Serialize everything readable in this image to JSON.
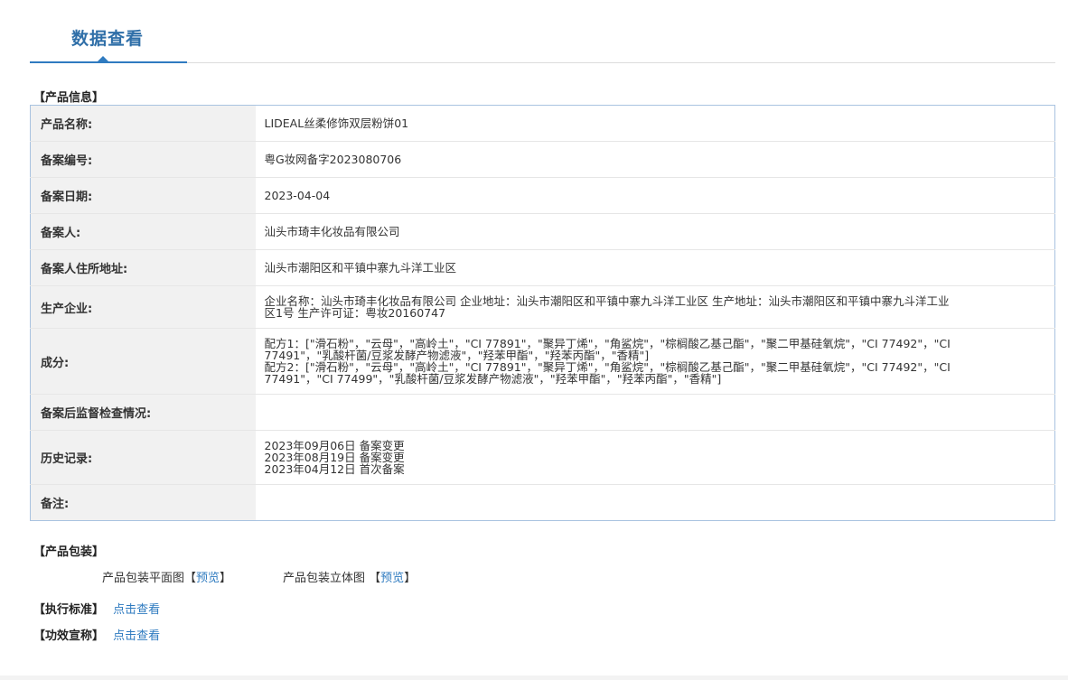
{
  "header": {
    "tab_title": "数据查看"
  },
  "product_info": {
    "section_title": "【产品信息】",
    "rows": [
      {
        "label": "产品名称:",
        "lines": [
          "LIDEAL丝柔修饰双层粉饼01"
        ]
      },
      {
        "label": "备案编号:",
        "lines": [
          "粤G妆网备字2023080706"
        ]
      },
      {
        "label": "备案日期:",
        "lines": [
          "2023-04-04"
        ]
      },
      {
        "label": "备案人:",
        "lines": [
          "汕头市琦丰化妆品有限公司"
        ]
      },
      {
        "label": "备案人住所地址:",
        "lines": [
          "汕头市潮阳区和平镇中寨九斗洋工业区"
        ]
      },
      {
        "label": "生产企业:",
        "lines": [
          "企业名称：汕头市琦丰化妆品有限公司 企业地址：汕头市潮阳区和平镇中寨九斗洋工业区 生产地址：汕头市潮阳区和平镇中寨九斗洋工业",
          "区1号 生产许可证：粤妆20160747"
        ]
      },
      {
        "label": "成分:",
        "lines": [
          "配方1：[\"滑石粉\"，\"云母\"，\"高岭土\"，\"CI 77891\"，\"聚异丁烯\"，\"角鲨烷\"，\"棕榈酸乙基己酯\"，\"聚二甲基硅氧烷\"，\"CI 77492\"，\"CI",
          "77491\"，\"乳酸杆菌/豆浆发酵产物滤液\"，\"羟苯甲酯\"，\"羟苯丙酯\"，\"香精\"]",
          "配方2：[\"滑石粉\"，\"云母\"，\"高岭土\"，\"CI 77891\"，\"聚异丁烯\"，\"角鲨烷\"，\"棕榈酸乙基己酯\"，\"聚二甲基硅氧烷\"，\"CI 77492\"，\"CI",
          "77491\"，\"CI 77499\"，\"乳酸杆菌/豆浆发酵产物滤液\"，\"羟苯甲酯\"，\"羟苯丙酯\"，\"香精\"]"
        ]
      },
      {
        "label": "备案后监督检查情况:",
        "lines": []
      },
      {
        "label": "历史记录:",
        "lines": [
          "2023年09月06日 备案变更",
          "2023年08月19日 备案变更",
          "2023年04月12日 首次备案"
        ]
      },
      {
        "label": "备注:",
        "lines": []
      }
    ]
  },
  "packaging": {
    "section_title": "【产品包装】",
    "flat_label": "产品包装平面图",
    "solid_label": "产品包装立体图",
    "bracket_open": "【",
    "bracket_close": "】",
    "preview_link": "预览"
  },
  "standard": {
    "section_title": "【执行标准】",
    "link": "点击查看"
  },
  "efficacy": {
    "section_title": "【功效宣称】",
    "link": "点击查看"
  }
}
